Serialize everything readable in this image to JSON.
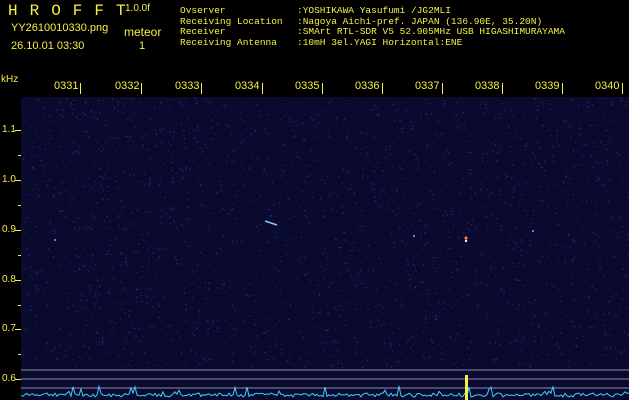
{
  "header": {
    "app_title": "HROFFT",
    "app_version": "1.0.0f",
    "file_name": "YY2610010330.png",
    "timestamp": "26.10.01 03:30",
    "meteor_label": "meteor",
    "meteor_count": "1"
  },
  "info": [
    {
      "key": "Ovserver",
      "value": ":YOSHIKAWA Yasufumi /JG2MLI"
    },
    {
      "key": "Receiving Location",
      "value": ":Nagoya Aichi-pref. JAPAN (136.90E, 35.20N)"
    },
    {
      "key": "Receiver",
      "value": ":SMArt RTL-SDR V5 52.905MHz USB HIGASHIMURAYAMA"
    },
    {
      "key": "Receiving Antenna",
      "value": ":10mH 3el.YAGI Horizontal:ENE"
    }
  ],
  "axes": {
    "freq_unit": "kHz",
    "freq_labels": [
      "1.1",
      "1.0",
      "0.9",
      "0.8",
      "0.7",
      "0.6"
    ],
    "time_labels": [
      "0331",
      "0332",
      "0333",
      "0334",
      "0335",
      "0336",
      "0337",
      "0338",
      "0339",
      "0340"
    ]
  },
  "colors": {
    "text": "#f5f045",
    "background": "#000000",
    "noise_floor": "#0a0a2e",
    "echo": "#ffffff",
    "baseline_trace": "#3fd0ff"
  },
  "detections": {
    "meteor_echo_count": 1
  }
}
